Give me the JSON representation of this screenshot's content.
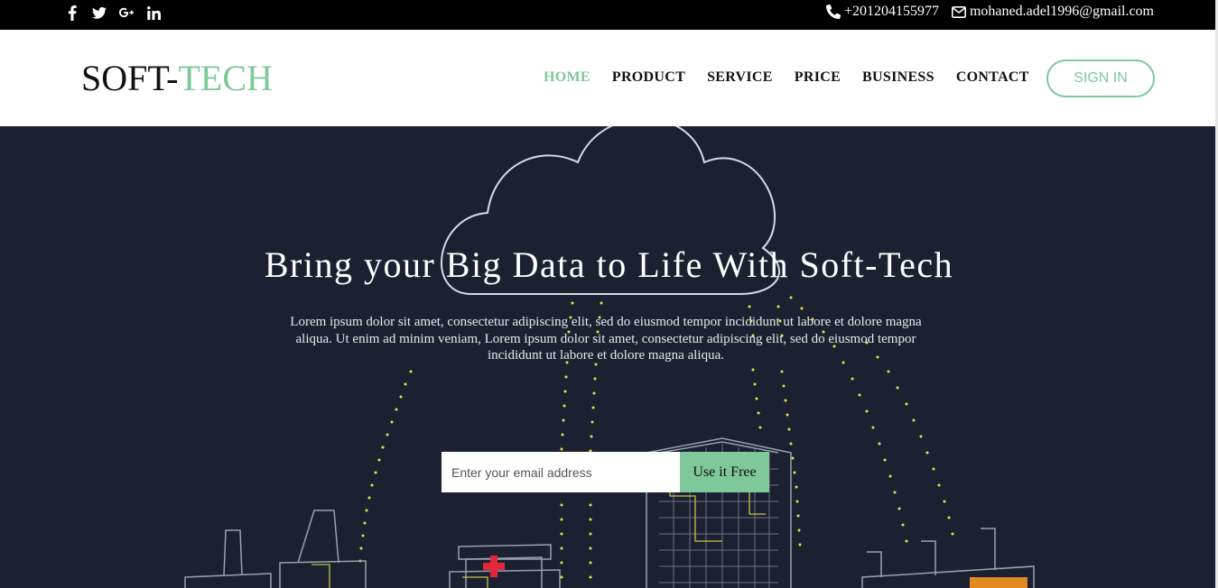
{
  "topbar": {
    "social": [
      "facebook-icon",
      "twitter-icon",
      "google-plus-icon",
      "linkedin-icon"
    ],
    "phone": "+201204155977",
    "email": "mohaned.adel1996@gmail.com"
  },
  "navbar": {
    "logo_main": "SOFT-",
    "logo_accent": "TECH",
    "menu": [
      "HOME",
      "PRODUCT",
      "SERVICE",
      "PRICE",
      "BUSINESS",
      "CONTACT"
    ],
    "active_item": "HOME",
    "signin_label": "SIGN IN"
  },
  "hero": {
    "title": "Bring your Big Data to Life With Soft-Tech",
    "text": "Lorem ipsum dolor sit amet, consectetur adipiscing elit, sed do eiusmod tempor incididunt ut labore et dolore magna aliqua. Ut enim ad minim veniam, Lorem ipsum dolor sit amet, consectetur adipiscing elit, sed do eiusmod tempor incididunt ut labore et dolore magna aliqua.",
    "email_placeholder": "Enter your email address",
    "cta_label": "Use it Free"
  },
  "colors": {
    "accent": "#7ec89a",
    "hero_bg": "#1b2130",
    "topbar_bg": "#000000"
  }
}
